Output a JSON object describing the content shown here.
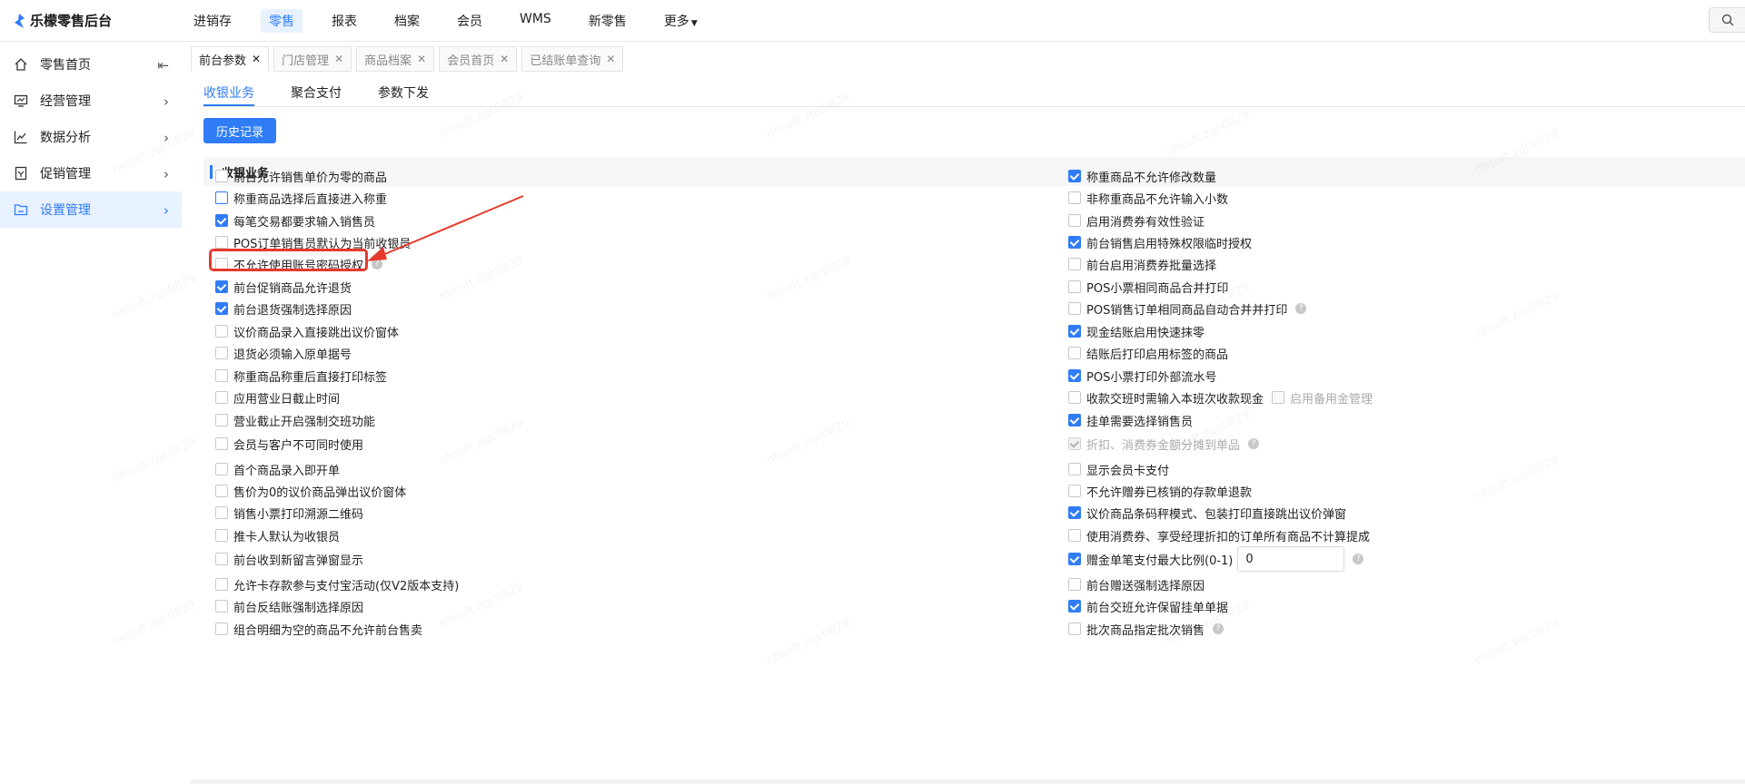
{
  "app": {
    "title": "乐檬零售后台"
  },
  "topnav": [
    {
      "label": "进销存",
      "active": false
    },
    {
      "label": "零售",
      "active": true
    },
    {
      "label": "报表",
      "active": false
    },
    {
      "label": "档案",
      "active": false
    },
    {
      "label": "会员",
      "active": false
    },
    {
      "label": "WMS",
      "active": false
    },
    {
      "label": "新零售",
      "active": false
    },
    {
      "label": "更多",
      "active": false
    }
  ],
  "sidebar": [
    {
      "label": "零售首页",
      "icon": "home-icon"
    },
    {
      "label": "经营管理",
      "icon": "monitor-icon"
    },
    {
      "label": "数据分析",
      "icon": "line-chart-icon"
    },
    {
      "label": "促销管理",
      "icon": "promotion-icon"
    },
    {
      "label": "设置管理",
      "icon": "settings-folder-icon",
      "active": true
    }
  ],
  "tabs": [
    {
      "label": "前台参数",
      "active": true
    },
    {
      "label": "门店管理"
    },
    {
      "label": "商品档案"
    },
    {
      "label": "会员首页"
    },
    {
      "label": "已结账单查询"
    }
  ],
  "subtabs": [
    {
      "label": "收银业务",
      "active": true
    },
    {
      "label": "聚合支付"
    },
    {
      "label": "参数下发"
    }
  ],
  "history_button": "历史记录",
  "section_title": "收银业务",
  "left_options": [
    {
      "label": "前台允许销售单价为零的商品",
      "checked": false
    },
    {
      "label": "称重商品选择后直接进入称重",
      "checked": false
    },
    {
      "label": "每笔交易都要求输入销售员",
      "checked": true
    },
    {
      "label": "POS订单销售员默认为当前收银员",
      "checked": false
    },
    {
      "label": "不允许使用账号密码授权",
      "checked": false,
      "help": "?"
    },
    {
      "label": "前台促销商品允许退货",
      "checked": true
    },
    {
      "label": "前台退货强制选择原因",
      "checked": true
    },
    {
      "label": "议价商品录入直接跳出议价窗体",
      "checked": false
    },
    {
      "label": "退货必须输入原单据号",
      "checked": false
    },
    {
      "label": "称重商品称重后直接打印标签",
      "checked": false
    },
    {
      "label": "应用营业日截止时间",
      "checked": false
    },
    {
      "label": "营业截止开启强制交班功能",
      "checked": false
    },
    {
      "label": "会员与客户不可同时使用",
      "checked": false
    },
    {
      "label": "首个商品录入即开单",
      "checked": false
    },
    {
      "label": "售价为0的议价商品弹出议价窗体",
      "checked": false
    },
    {
      "label": "销售小票打印溯源二维码",
      "checked": false
    },
    {
      "label": "推卡人默认为收银员",
      "checked": false
    },
    {
      "label": "前台收到新留言弹窗显示",
      "checked": false
    },
    {
      "label": "允许卡存款参与支付宝活动(仅V2版本支持)",
      "checked": false
    },
    {
      "label": "前台反结账强制选择原因",
      "checked": false
    },
    {
      "label": "组合明细为空的商品不允许前台售卖",
      "checked": false
    }
  ],
  "right_options": [
    {
      "label": "称重商品不允许修改数量",
      "checked": true
    },
    {
      "label": "非称重商品不允许输入小数",
      "checked": false
    },
    {
      "label": "启用消费券有效性验证",
      "checked": false
    },
    {
      "label": "前台销售启用特殊权限临时授权",
      "checked": true
    },
    {
      "label": "前台启用消费券批量选择",
      "checked": false
    },
    {
      "label": "POS小票相同商品合并打印",
      "checked": false
    },
    {
      "label": "POS销售订单相同商品自动合并并打印",
      "checked": false,
      "help": "?"
    },
    {
      "label": "现金结账启用快速抹零",
      "checked": true
    },
    {
      "label": "结账后打印启用标签的商品",
      "checked": false
    },
    {
      "label": "POS小票打印外部流水号",
      "checked": true
    },
    {
      "label": "收款交班时需输入本班次收款现金",
      "checked": false,
      "sub_label": "启用备用金管理"
    },
    {
      "label": "挂单需要选择销售员",
      "checked": true
    },
    {
      "label": "折扣、消费券金额分摊到单品",
      "checked": true,
      "disabled": true,
      "help": "?"
    },
    {
      "label": "显示会员卡支付",
      "checked": false
    },
    {
      "label": "不允许赠券已核销的存款单退款",
      "checked": false
    },
    {
      "label": "议价商品条码秤模式、包装打印直接跳出议价弹窗",
      "checked": true
    },
    {
      "label": "使用消费券、享受经理折扣的订单所有商品不计算提成",
      "checked": false
    },
    {
      "label": "赠金单笔支付最大比例(0-1)",
      "checked": true,
      "input_value": "0",
      "help": "?"
    },
    {
      "label": "前台赠送强制选择原因",
      "checked": false
    },
    {
      "label": "前台交班允许保留挂单单据",
      "checked": true
    },
    {
      "label": "批次商品指定批次销售",
      "checked": false,
      "help": "?"
    }
  ],
  "watermark": "nhsoft.zqc0829",
  "colors": {
    "accent": "#2f7cf6",
    "annotation": "#e53b2c"
  }
}
